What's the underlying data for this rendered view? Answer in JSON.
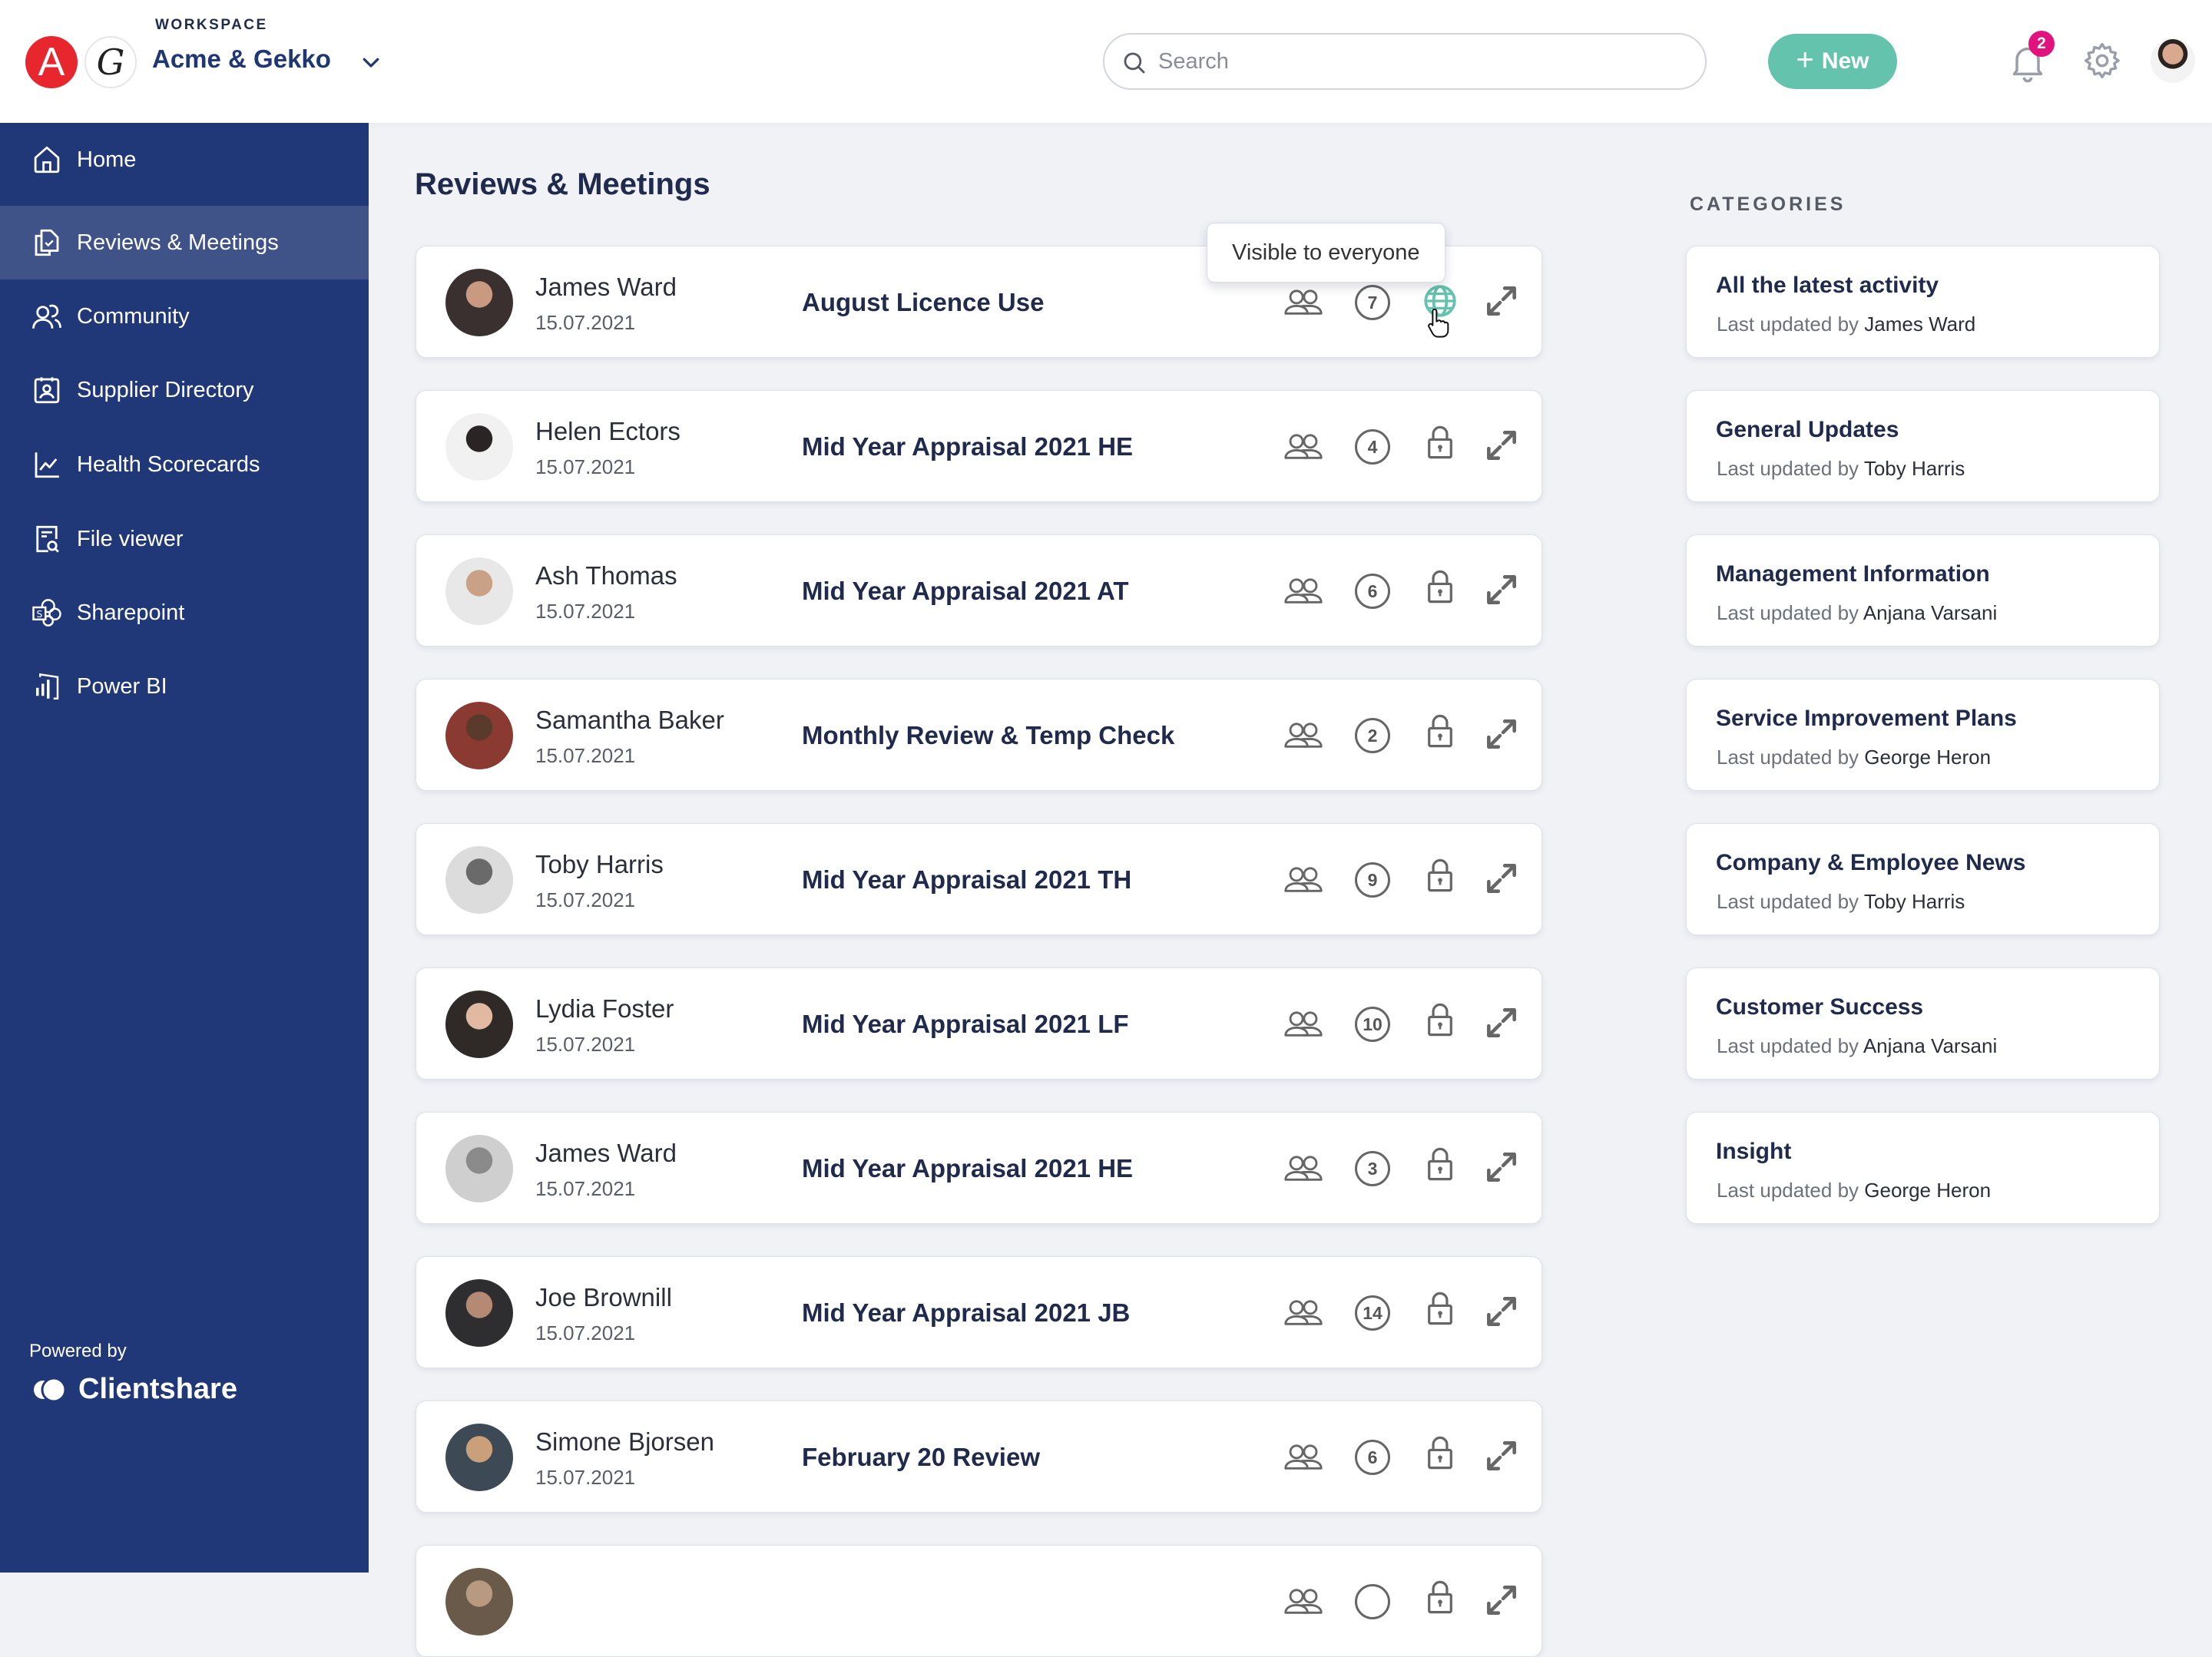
{
  "header": {
    "workspace_label": "WORKSPACE",
    "workspace_name": "Acme & Gekko",
    "logo_a_letter": "A",
    "logo_g_letter": "G",
    "search_placeholder": "Search",
    "search_value": "",
    "new_button": "New",
    "new_button_icon": "plus-icon",
    "notification_count": "2",
    "accent_color": "#63c3ac",
    "badge_color": "#e2117e"
  },
  "sidebar": {
    "background_color": "#213878",
    "items": [
      {
        "label": "Home",
        "icon": "home-icon",
        "active": false
      },
      {
        "label": "Reviews & Meetings",
        "icon": "documents-check-icon",
        "active": true
      },
      {
        "label": "Community",
        "icon": "users-icon",
        "active": false
      },
      {
        "label": "Supplier Directory",
        "icon": "contact-card-icon",
        "active": false
      },
      {
        "label": "Health Scorecards",
        "icon": "line-chart-icon",
        "active": false
      },
      {
        "label": "File viewer",
        "icon": "file-search-icon",
        "active": false
      },
      {
        "label": "Sharepoint",
        "icon": "sharepoint-icon",
        "active": false
      },
      {
        "label": "Power BI",
        "icon": "power-bi-icon",
        "active": false
      }
    ],
    "powered_by": "Powered by",
    "brand": "Clientshare"
  },
  "main": {
    "title": "Reviews & Meetings",
    "tooltip": "Visible to everyone",
    "rows": [
      {
        "name": "James Ward",
        "date": "15.07.2021",
        "title": "August Licence Use",
        "count": "7",
        "visibility": "public"
      },
      {
        "name": "Helen Ectors",
        "date": "15.07.2021",
        "title": "Mid Year Appraisal 2021 HE",
        "count": "4",
        "visibility": "private"
      },
      {
        "name": "Ash Thomas",
        "date": "15.07.2021",
        "title": "Mid Year Appraisal 2021 AT",
        "count": "6",
        "visibility": "private"
      },
      {
        "name": "Samantha Baker",
        "date": "15.07.2021",
        "title": "Monthly Review & Temp Check",
        "count": "2",
        "visibility": "private"
      },
      {
        "name": "Toby Harris",
        "date": "15.07.2021",
        "title": "Mid Year Appraisal 2021 TH",
        "count": "9",
        "visibility": "private"
      },
      {
        "name": "Lydia Foster",
        "date": "15.07.2021",
        "title": "Mid Year Appraisal 2021 LF",
        "count": "10",
        "visibility": "private"
      },
      {
        "name": "James Ward",
        "date": "15.07.2021",
        "title": "Mid Year Appraisal 2021 HE",
        "count": "3",
        "visibility": "private"
      },
      {
        "name": "Joe Brownill",
        "date": "15.07.2021",
        "title": "Mid Year Appraisal 2021 JB",
        "count": "14",
        "visibility": "private"
      },
      {
        "name": "Simone Bjorsen",
        "date": "15.07.2021",
        "title": "February 20 Review",
        "count": "6",
        "visibility": "private"
      },
      {
        "name": "",
        "date": "",
        "title": "",
        "count": "",
        "visibility": "private"
      }
    ]
  },
  "categories": {
    "header": "CATEGORIES",
    "prefix": "Last updated by",
    "items": [
      {
        "title": "All the latest activity",
        "updated_by": "James Ward"
      },
      {
        "title": "General Updates",
        "updated_by": "Toby Harris"
      },
      {
        "title": "Management Information",
        "updated_by": "Anjana Varsani"
      },
      {
        "title": "Service Improvement Plans",
        "updated_by": "George Heron"
      },
      {
        "title": "Company & Employee News",
        "updated_by": "Toby Harris"
      },
      {
        "title": "Customer Success",
        "updated_by": "Anjana Varsani"
      },
      {
        "title": "Insight",
        "updated_by": "George Heron"
      }
    ]
  }
}
